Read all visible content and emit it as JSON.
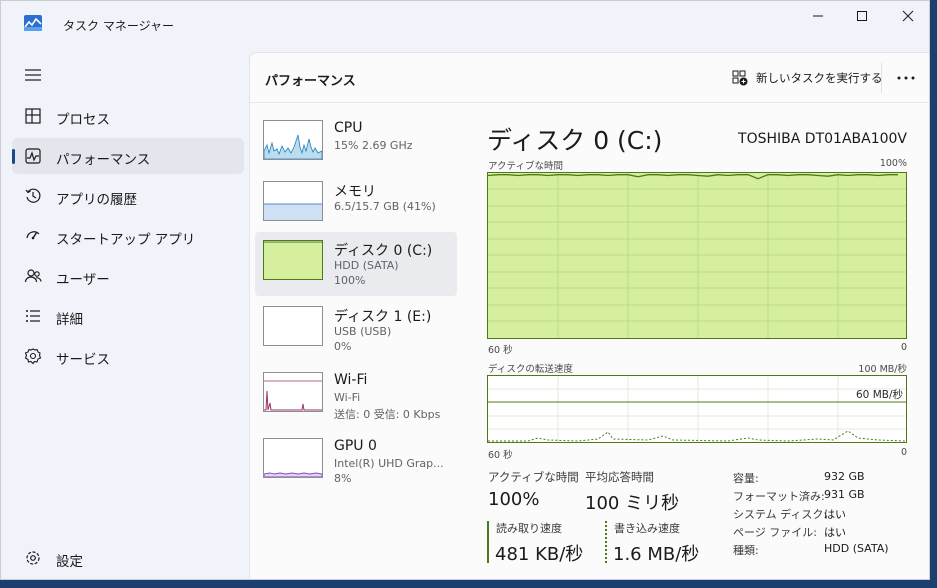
{
  "window": {
    "title": "タスク マネージャー",
    "controls": {
      "minimize": "minimize",
      "maximize": "maximize",
      "close": "close"
    }
  },
  "sidebar": {
    "items": [
      {
        "label": "プロセス",
        "icon": "processes-icon"
      },
      {
        "label": "パフォーマンス",
        "icon": "performance-icon",
        "active": true
      },
      {
        "label": "アプリの履歴",
        "icon": "history-icon"
      },
      {
        "label": "スタートアップ アプリ",
        "icon": "startup-icon"
      },
      {
        "label": "ユーザー",
        "icon": "users-icon"
      },
      {
        "label": "詳細",
        "icon": "details-icon"
      },
      {
        "label": "サービス",
        "icon": "services-icon"
      }
    ],
    "settings": {
      "label": "設定",
      "icon": "settings-icon"
    }
  },
  "header": {
    "title": "パフォーマンス",
    "run_task_label": "新しいタスクを実行する",
    "more_icon": "more-icon"
  },
  "devices": [
    {
      "name": "CPU",
      "sub1": "15%  2.69 GHz",
      "sub2": ""
    },
    {
      "name": "メモリ",
      "sub1": "6.5/15.7 GB (41%)",
      "sub2": ""
    },
    {
      "name": "ディスク 0 (C:)",
      "sub1": "HDD (SATA)",
      "sub2": "100%",
      "selected": true
    },
    {
      "name": "ディスク 1 (E:)",
      "sub1": "USB (USB)",
      "sub2": "0%"
    },
    {
      "name": "Wi-Fi",
      "sub1": "Wi-Fi",
      "sub2": "送信: 0  受信: 0 Kbps"
    },
    {
      "name": "GPU 0",
      "sub1": "Intel(R) UHD Grap...",
      "sub2": "8%"
    }
  ],
  "detail": {
    "title": "ディスク 0 (C:)",
    "model": "TOSHIBA DT01ABA100V",
    "active_graph": {
      "label": "アクティブな時間",
      "max": "100%",
      "x_left": "60 秒",
      "x_right": "0",
      "level_percent": 99
    },
    "transfer_graph": {
      "label": "ディスクの転送速度",
      "max": "100 MB/秒",
      "marker": "60 MB/秒",
      "x_left": "60 秒",
      "x_right": "0"
    },
    "stats": {
      "active_time_label": "アクティブな時間",
      "active_time_value": "100%",
      "avg_response_label": "平均応答時間",
      "avg_response_value": "100 ミリ秒",
      "read_label": "読み取り速度",
      "read_value": "481 KB/秒",
      "write_label": "書き込み速度",
      "write_value": "1.6 MB/秒"
    },
    "properties": [
      {
        "label": "容量:",
        "value": "932 GB"
      },
      {
        "label": "フォーマット済み:",
        "value": "931 GB"
      },
      {
        "label": "システム ディスク:",
        "value": "はい"
      },
      {
        "label": "ページ ファイル:",
        "value": "はい"
      },
      {
        "label": "種類:",
        "value": "HDD (SATA)"
      }
    ]
  },
  "colors": {
    "disk_fill": "#d5ef9f",
    "disk_line": "#4d7a18",
    "cpu_line": "#1f7fbf",
    "memory_fill": "#cfe0f5",
    "wifi_line": "#a0306a",
    "gpu_line": "#8a44c4"
  }
}
